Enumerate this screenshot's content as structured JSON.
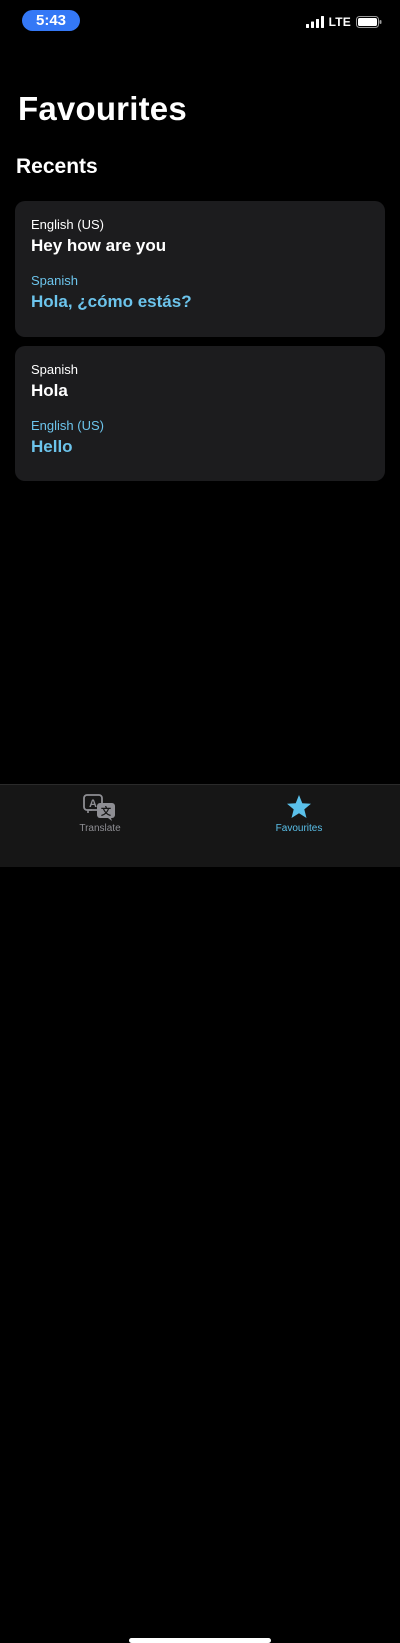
{
  "status_bar": {
    "time": "5:43",
    "network": "LTE",
    "icons": [
      "signal-icon",
      "battery-icon"
    ]
  },
  "page": {
    "title": "Favourites",
    "section_heading": "Recents"
  },
  "recents": [
    {
      "source_language": "English (US)",
      "source_text": "Hey how are you",
      "target_language": "Spanish",
      "target_text": "Hola, ¿cómo estás?"
    },
    {
      "source_language": "Spanish",
      "source_text": "Hola",
      "target_language": "English (US)",
      "target_text": "Hello"
    }
  ],
  "tab_bar": {
    "tabs": [
      {
        "label": "Translate",
        "icon": "translate-icon",
        "selected": false
      },
      {
        "label": "Favourites",
        "icon": "star-icon",
        "selected": true
      }
    ]
  },
  "colors": {
    "background": "#000000",
    "card": "#1c1c1e",
    "accent": "#6cc4ec",
    "time_pill": "#3478f6",
    "tab_inactive": "#8e8e93"
  }
}
